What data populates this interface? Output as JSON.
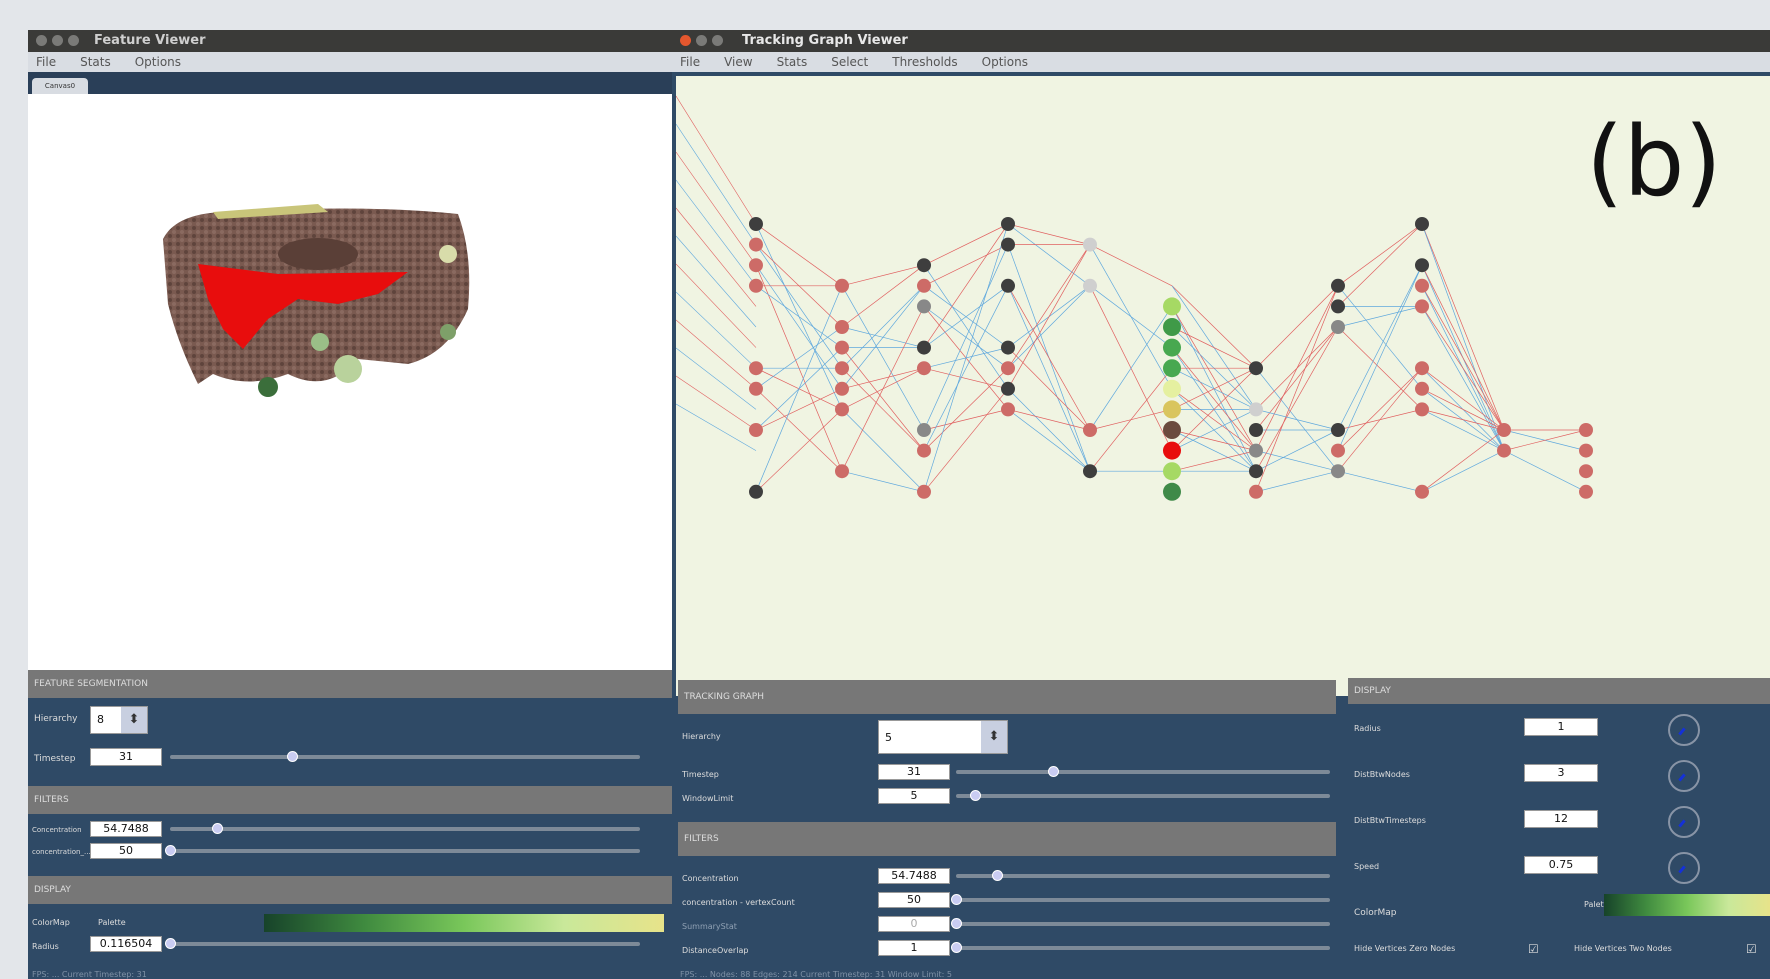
{
  "feature_viewer": {
    "title": "Feature Viewer",
    "menu": [
      "File",
      "Stats",
      "Options"
    ],
    "tab": "Canvas0",
    "segmentation": {
      "header": "FEATURE SEGMENTATION",
      "hierarchy_label": "Hierarchy",
      "hierarchy_value": "8",
      "timestep_label": "Timestep",
      "timestep_value": "31",
      "timestep_pos": 0.26
    },
    "filters": {
      "header": "FILTERS",
      "rows": [
        {
          "label": "Concentration",
          "value": "54.7488",
          "pos": 0.1
        },
        {
          "label": "concentration_...",
          "value": "50",
          "pos": 0.0
        }
      ]
    },
    "display": {
      "header": "DISPLAY",
      "colormap_label": "ColorMap",
      "colormap_value": "Palette",
      "radius_label": "Radius",
      "radius_value": "0.116504",
      "radius_pos": 0.0
    },
    "status": "FPS: ... Current Timestep: 31"
  },
  "graph_viewer": {
    "title": "Tracking Graph Viewer",
    "menu": [
      "File",
      "View",
      "Stats",
      "Select",
      "Thresholds",
      "Options"
    ],
    "panel_letter": "(b)",
    "tracking": {
      "header": "TRACKING GRAPH",
      "hierarchy_label": "Hierarchy",
      "hierarchy_value": "5",
      "rows": [
        {
          "label": "Timestep",
          "value": "31",
          "pos": 0.26
        },
        {
          "label": "WindowLimit",
          "value": "5",
          "pos": 0.05
        }
      ]
    },
    "filters": {
      "header": "FILTERS",
      "rows": [
        {
          "label": "Concentration",
          "value": "54.7488",
          "pos": 0.11
        },
        {
          "label": "concentration - vertexCount",
          "value": "50",
          "pos": 0.0
        },
        {
          "label": "SummaryStat",
          "value": "0",
          "pos": 0.0
        },
        {
          "label": "DistanceOverlap",
          "value": "1",
          "pos": 0.0
        }
      ]
    },
    "display": {
      "header": "DISPLAY",
      "rows": [
        {
          "label": "Radius",
          "value": "1"
        },
        {
          "label": "DistBtwNodes",
          "value": "3"
        },
        {
          "label": "DistBtwTimesteps",
          "value": "12"
        },
        {
          "label": "Speed",
          "value": "0.75"
        }
      ],
      "colormap_label": "ColorMap",
      "colormap_value": "Palette",
      "hide_zero_label": "Hide Vertices Zero Nodes",
      "hide_two_label": "Hide Vertices Two Nodes"
    },
    "status": "FPS: ... Nodes: 88 Edges: 214 Current Timestep: 31 Window Limit: 5"
  },
  "colors": {
    "panel_bg": "#2f4a66",
    "graph_bg": "#f0f4e2",
    "red_node": "#cd6b67",
    "dark_node": "#3e3e3e",
    "blue_edge": "#5fa8dd",
    "red_edge": "#e06060",
    "segmentation_red": "#e80d0d",
    "feature_brown": "#7a5a50"
  }
}
